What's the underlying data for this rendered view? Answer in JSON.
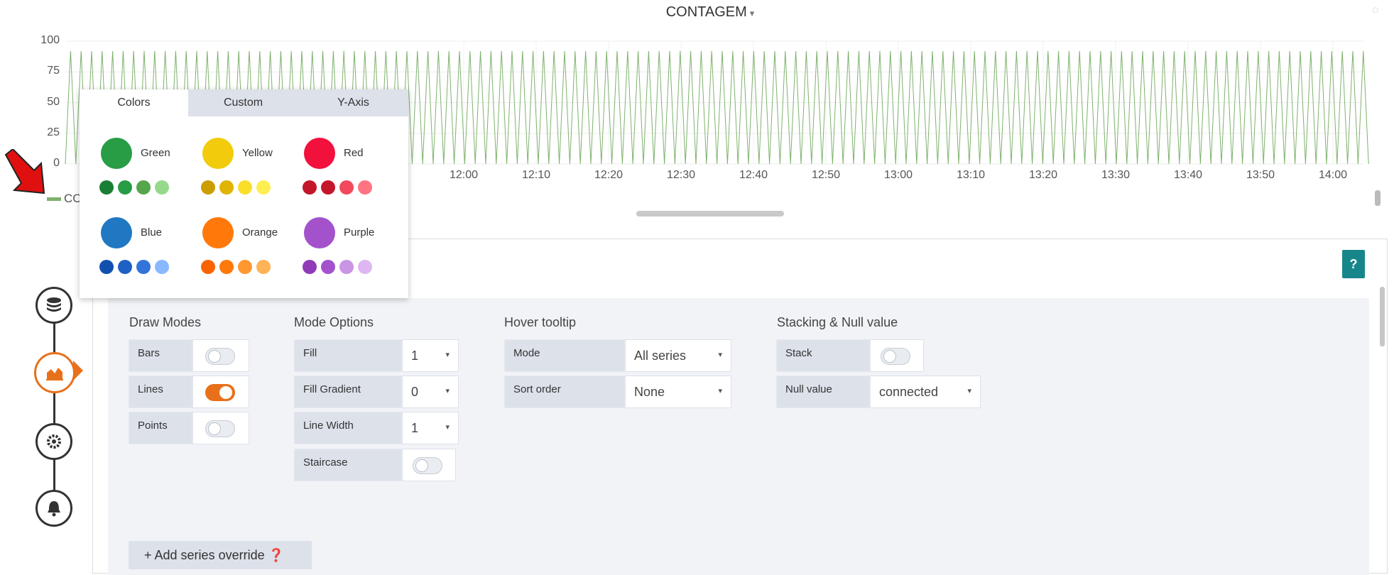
{
  "panel": {
    "title": "CONTAGEM",
    "caret": "▾",
    "loading_icon": "spinner-icon"
  },
  "chart_data": {
    "type": "line",
    "y_ticks": [
      "100",
      "75",
      "50",
      "25",
      "0"
    ],
    "x_ticks": [
      "12:00",
      "12:10",
      "12:20",
      "12:30",
      "12:40",
      "12:50",
      "13:00",
      "13:10",
      "13:20",
      "13:30",
      "13:40",
      "13:50",
      "14:00"
    ],
    "ylim": [
      0,
      100
    ],
    "series": [
      {
        "name": "CONTAGEM",
        "color": "#7eb26d",
        "pattern": "sawtooth",
        "min": 0,
        "max": 92
      }
    ]
  },
  "legend": {
    "label": "CC"
  },
  "popover": {
    "tabs": [
      "Colors",
      "Custom",
      "Y-Axis"
    ],
    "colors": [
      {
        "name": "Green",
        "main": "#299c46",
        "shades": [
          "#1a7f35",
          "#299c46",
          "#56a64b",
          "#96d98d"
        ]
      },
      {
        "name": "Yellow",
        "main": "#f2cc0c",
        "shades": [
          "#cc9d00",
          "#e0b400",
          "#fade2a",
          "#ffee52"
        ]
      },
      {
        "name": "Red",
        "main": "#f2113c",
        "shades": [
          "#c4162a",
          "#c4162a",
          "#f2495c",
          "#ff7383"
        ]
      },
      {
        "name": "Blue",
        "main": "#1f78c1",
        "shades": [
          "#1250b0",
          "#1f60c4",
          "#3274d9",
          "#8ab8ff"
        ]
      },
      {
        "name": "Orange",
        "main": "#ff780a",
        "shades": [
          "#fa6400",
          "#ff780a",
          "#ff9830",
          "#ffb357"
        ]
      },
      {
        "name": "Purple",
        "main": "#a352cc",
        "shades": [
          "#8f3bb8",
          "#a352cc",
          "#ca95e5",
          "#deb6f2"
        ]
      }
    ]
  },
  "nav": {
    "icons": [
      "database-icon",
      "chart-area-icon",
      "gear-icon",
      "bell-icon"
    ]
  },
  "help": {
    "label": "?"
  },
  "draw_modes": {
    "title": "Draw Modes",
    "rows": [
      {
        "label": "Bars",
        "on": false
      },
      {
        "label": "Lines",
        "on": true
      },
      {
        "label": "Points",
        "on": false
      }
    ]
  },
  "mode_options": {
    "title": "Mode Options",
    "fill": {
      "label": "Fill",
      "value": "1"
    },
    "fill_gradient": {
      "label": "Fill Gradient",
      "value": "0"
    },
    "line_width": {
      "label": "Line Width",
      "value": "1"
    },
    "staircase": {
      "label": "Staircase",
      "on": false
    }
  },
  "hover_tooltip": {
    "title": "Hover tooltip",
    "mode": {
      "label": "Mode",
      "value": "All series"
    },
    "sort_order": {
      "label": "Sort order",
      "value": "None"
    }
  },
  "stacking": {
    "title": "Stacking & Null value",
    "stack": {
      "label": "Stack",
      "on": false
    },
    "null_value": {
      "label": "Null value",
      "value": "connected"
    }
  },
  "add_override": {
    "label": "+ Add series override ❓"
  },
  "caret": "▾"
}
